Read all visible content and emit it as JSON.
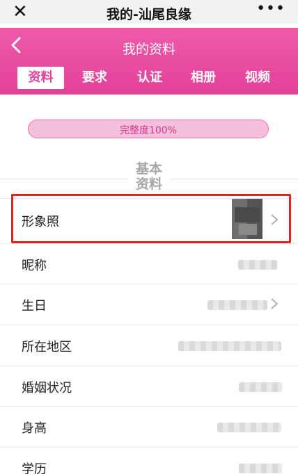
{
  "wechat_bar": {
    "close_glyph": "✕",
    "title": "我的-汕尾良缘",
    "more_glyph": "•••"
  },
  "header": {
    "title": "我的资料",
    "back_icon": "chevron-left-icon"
  },
  "tabs": [
    {
      "label": "资料",
      "active": true
    },
    {
      "label": "要求",
      "active": false
    },
    {
      "label": "认证",
      "active": false
    },
    {
      "label": "相册",
      "active": false
    },
    {
      "label": "视频",
      "active": false
    }
  ],
  "completeness": {
    "text": "完整度100%",
    "percent": 100
  },
  "section": {
    "title_line1": "基本",
    "title_line2": "资料"
  },
  "rows": [
    {
      "label": "形象照"
    },
    {
      "label": "昵称"
    },
    {
      "label": "生日"
    },
    {
      "label": "所在地区"
    },
    {
      "label": "婚姻状况"
    },
    {
      "label": "身高"
    },
    {
      "label": "学历"
    }
  ],
  "colors": {
    "brand_pink": "#e4419a",
    "highlight_red": "#e22121"
  }
}
